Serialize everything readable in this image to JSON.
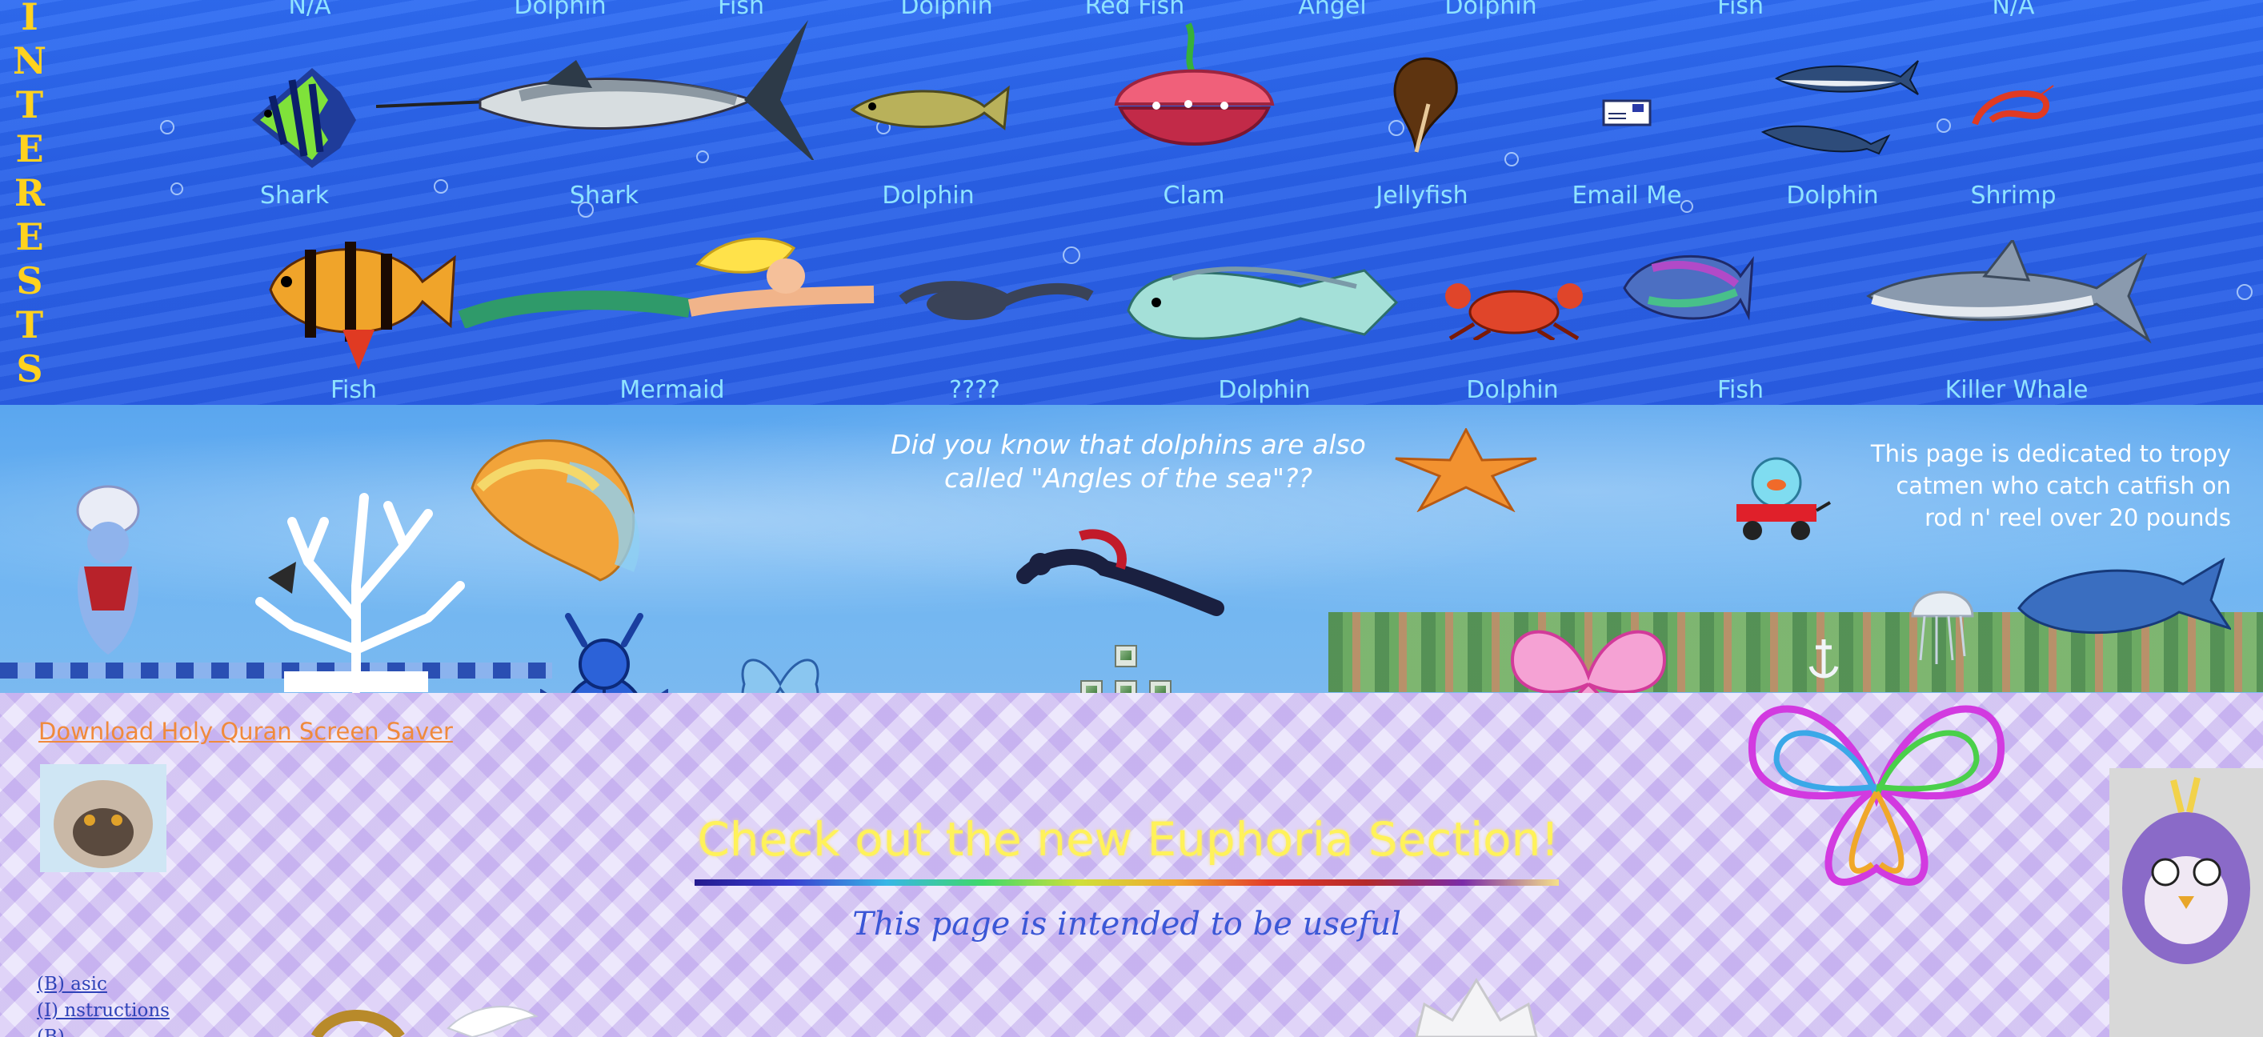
{
  "sidebar": {
    "letters": [
      "I",
      "N",
      "T",
      "E",
      "R",
      "E",
      "S",
      "T",
      "S"
    ]
  },
  "ocean": {
    "row0_labels": [
      "N/A",
      "Dolphin",
      "Fish",
      "Dolphin",
      "Red Fish",
      "Angel",
      "Dolphin",
      "Fish",
      "N/A"
    ],
    "row1_labels": [
      "Shark",
      "Shark",
      "Dolphin",
      "Clam",
      "Jellyfish",
      "Email Me",
      "Dolphin",
      "Shrimp"
    ],
    "row2_labels": [
      "Fish",
      "Mermaid",
      "????",
      "Dolphin",
      "Dolphin",
      "Fish",
      "Killer Whale"
    ]
  },
  "middle": {
    "fact_text": "Did you know that dolphins are also called \"Angles of the sea\"??",
    "dedication_text": "This page is dedicated to tropy catmen who catch catfish on rod n' reel over 20 pounds"
  },
  "lower": {
    "quran_link": "Download Holy Quran Screen Saver",
    "euphoria_text": "Check out the new Euphoria Section!",
    "useful_text": "This page is intended to be useful",
    "nav_links": [
      "(B) asic",
      "(I) nstructions",
      "(B) ..."
    ]
  },
  "colors": {
    "ocean_blue": "#2f6df2",
    "label_cyan": "#8fe3ff",
    "interests_yellow": "#ffd21f",
    "link_orange": "#f08a3c",
    "euphoria_yellow": "#fff25a",
    "useful_blue": "#3b57d6",
    "nav_blue": "#2f43b8"
  },
  "icons": [
    "angelfish",
    "swordfish",
    "walleye",
    "clam",
    "conch",
    "envelope",
    "shark",
    "shrimp",
    "tiger-barb",
    "mermaid",
    "plesiosaur",
    "mahi-mahi",
    "crab",
    "parrotfish",
    "great-white-shark",
    "genie",
    "shell",
    "coral",
    "scuba-diver",
    "starfish",
    "fishbowl-wagon",
    "jellyfish",
    "blue-whale",
    "scarab-beetle",
    "butterfly",
    "cat",
    "furby"
  ]
}
